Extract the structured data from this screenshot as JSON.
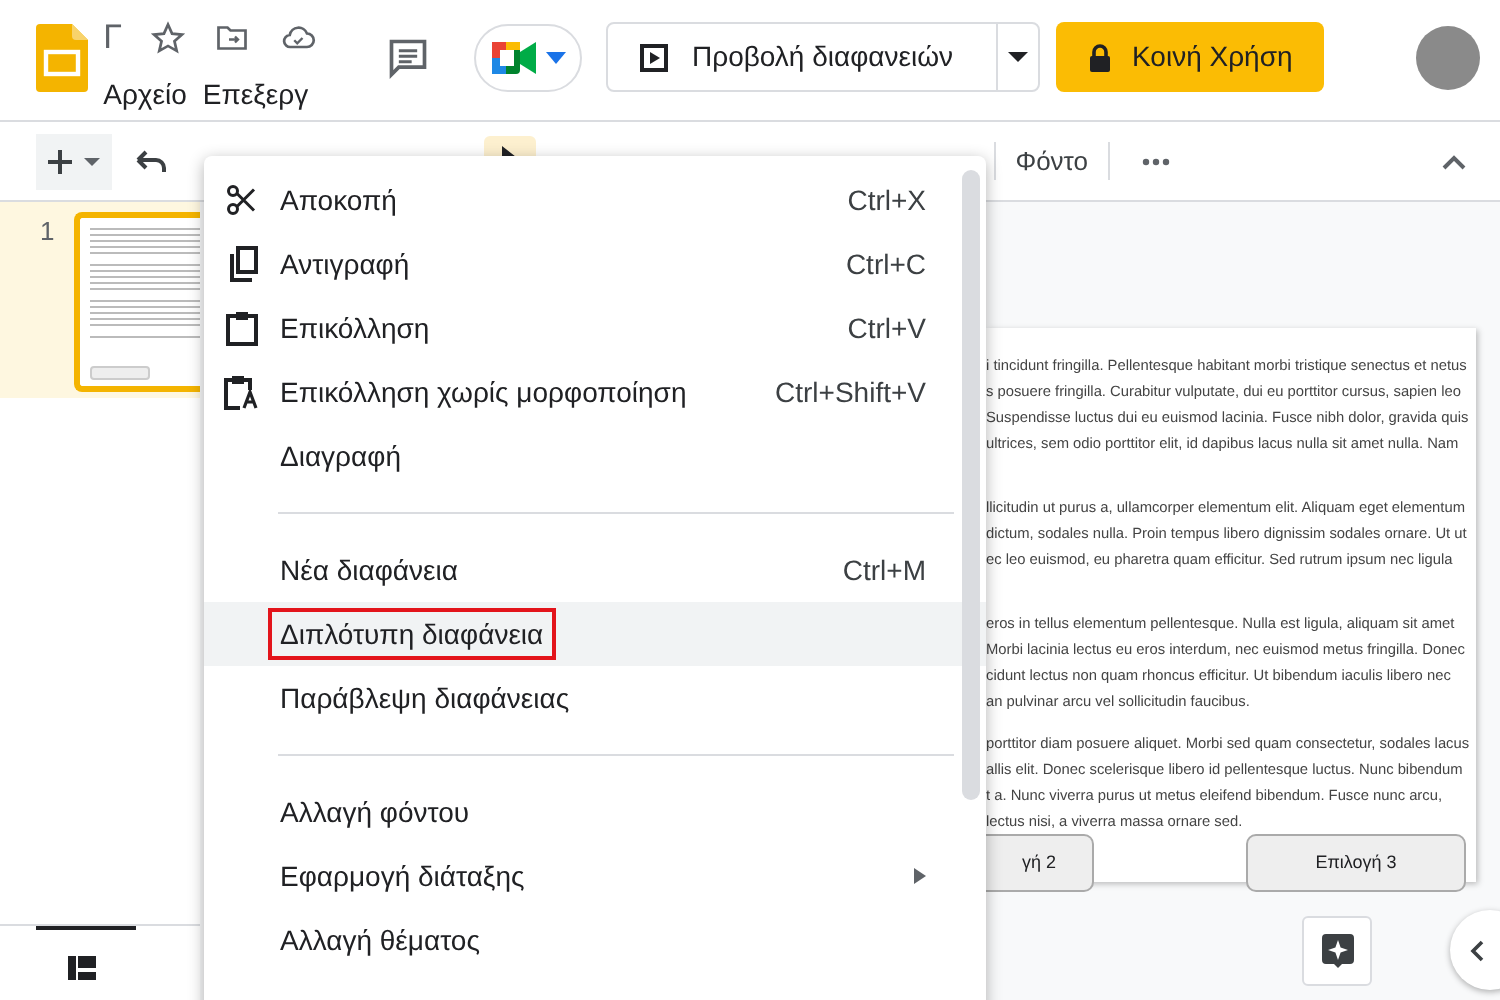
{
  "header": {
    "doc_title": "Γ",
    "menus": [
      {
        "label": "Αρχείο"
      },
      {
        "label": "Επεξεργ"
      }
    ],
    "slideshow_button": "Προβολή διαφανειών",
    "share_button": "Κοινή Χρήση"
  },
  "toolbar": {
    "select_tool_selected": true,
    "background_button": "Φόντο"
  },
  "filmstrip": {
    "slides": [
      {
        "number": "1",
        "selected": true
      }
    ]
  },
  "context_menu": {
    "groups": [
      [
        {
          "kind": "cut",
          "label": "Αποκοπή",
          "shortcut": "Ctrl+X",
          "highlighted": false,
          "outlined": false,
          "submenu": false
        },
        {
          "kind": "copy",
          "label": "Αντιγραφή",
          "shortcut": "Ctrl+C",
          "highlighted": false,
          "outlined": false,
          "submenu": false
        },
        {
          "kind": "paste",
          "label": "Επικόλληση",
          "shortcut": "Ctrl+V",
          "highlighted": false,
          "outlined": false,
          "submenu": false
        },
        {
          "kind": "paste-plain",
          "label": "Επικόλληση χωρίς μορφοποίηση",
          "shortcut": "Ctrl+Shift+V",
          "highlighted": false,
          "outlined": false,
          "submenu": false
        },
        {
          "kind": "plain",
          "label": "Διαγραφή",
          "highlighted": false,
          "outlined": false,
          "submenu": false
        }
      ],
      [
        {
          "kind": "plain",
          "label": "Νέα διαφάνεια",
          "shortcut": "Ctrl+M",
          "highlighted": false,
          "outlined": false,
          "submenu": false
        },
        {
          "kind": "plain",
          "label": "Διπλότυπη διαφάνεια",
          "highlighted": true,
          "outlined": true,
          "submenu": false
        },
        {
          "kind": "plain",
          "label": "Παράβλεψη διαφάνειας",
          "highlighted": false,
          "outlined": false,
          "submenu": false
        }
      ],
      [
        {
          "kind": "plain",
          "label": "Αλλαγή φόντου",
          "highlighted": false,
          "outlined": false,
          "submenu": false
        },
        {
          "kind": "plain",
          "label": "Εφαρμογή διάταξης",
          "highlighted": false,
          "outlined": false,
          "submenu": true
        },
        {
          "kind": "plain",
          "label": "Αλλαγή θέματος",
          "highlighted": false,
          "outlined": false,
          "submenu": false
        }
      ]
    ]
  },
  "slide": {
    "paragraphs": [
      [
        "i tincidunt fringilla. Pellentesque habitant morbi tristique senectus et netus",
        "s posuere fringilla. Curabitur vulputate, dui eu porttitor cursus, sapien leo",
        "Suspendisse luctus dui eu euismod lacinia. Fusce nibh dolor, gravida quis",
        "ultrices, sem odio porttitor elit, id dapibus lacus nulla sit amet nulla. Nam"
      ],
      [
        "llicitudin ut purus a, ullamcorper elementum elit. Aliquam eget elementum",
        "dictum, sodales nulla. Proin tempus libero dignissim sodales ornare. Ut ut",
        "ec leo euismod, eu pharetra quam efficitur. Sed rutrum ipsum nec ligula"
      ],
      [
        "eros in tellus elementum pellentesque. Nulla est ligula, aliquam sit amet",
        "Morbi lacinia lectus eu eros interdum, nec euismod metus fringilla. Donec",
        "cidunt lectus non quam rhoncus efficitur. Ut bibendum iaculis libero nec",
        "an pulvinar arcu vel sollicitudin faucibus."
      ],
      [
        "porttitor diam posuere aliquet. Morbi sed quam consectetur, sodales lacus",
        "allis elit. Donec scelerisque libero id pellentesque luctus. Nunc bibendum",
        "t a. Nunc viverra purus ut metus eleifend bibendum. Fusce nunc arcu,",
        "lectus nisi, a viverra massa ornare sed."
      ]
    ],
    "buttons": [
      "γή 2",
      "Επιλογή 3"
    ]
  }
}
